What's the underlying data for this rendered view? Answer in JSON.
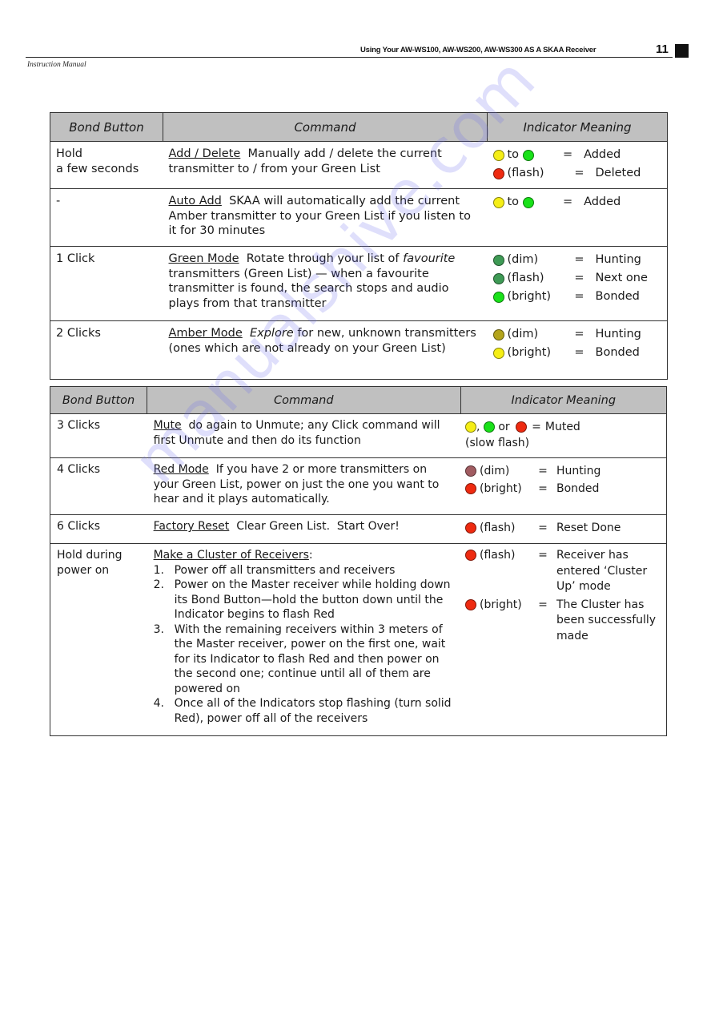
{
  "header": {
    "running_title": "Using Your AW-WS100, AW-WS200, AW-WS300 AS A SKAA Receiver",
    "page_number": "11",
    "manual_label": "Instruction Manual"
  },
  "tables": [
    {
      "headers": [
        "Bond Button",
        "Command",
        "Indicator Meaning"
      ],
      "rows": [
        {
          "button": [
            "Hold",
            "a few seconds"
          ],
          "command_title": "Add / Delete",
          "command_text": "Manually add / delete the current transmitter to / from your Green List",
          "indicators": [
            {
              "dots": [
                "yellow",
                "green"
              ],
              "state": "to",
              "meaning": "Added"
            },
            {
              "dots": [
                "red"
              ],
              "state": "(flash)",
              "meaning": "Deleted"
            }
          ]
        },
        {
          "button": [
            "-"
          ],
          "command_title": "Auto Add",
          "command_text": "SKAA will automatically add the current Amber transmitter to your Green List if you listen to it for 30 minutes",
          "indicators": [
            {
              "dots": [
                "yellow",
                "green"
              ],
              "state": "to",
              "meaning": "Added"
            }
          ]
        },
        {
          "button": [
            "1 Click"
          ],
          "command_title": "Green Mode",
          "command_text_pre": "Rotate through your list of",
          "command_text_em": "favourite",
          "command_text": "transmitters (Green List) — when a favourite transmitter is found, the search stops and audio plays from that transmitter",
          "indicators": [
            {
              "dots": [
                "green-dim"
              ],
              "state": "(dim)",
              "meaning": "Hunting"
            },
            {
              "dots": [
                "green-dim"
              ],
              "state": "(flash)",
              "meaning": "Next one"
            },
            {
              "dots": [
                "green"
              ],
              "state": "(bright)",
              "meaning": "Bonded"
            }
          ]
        },
        {
          "button": [
            "2 Clicks"
          ],
          "command_title": "Amber Mode",
          "command_text_em": "Explore",
          "command_text": "for new, unknown transmitters (ones which are not already on your Green List)",
          "indicators": [
            {
              "dots": [
                "amber-dim"
              ],
              "state": "(dim)",
              "meaning": "Hunting"
            },
            {
              "dots": [
                "yellow"
              ],
              "state": "(bright)",
              "meaning": "Bonded"
            }
          ]
        }
      ]
    },
    {
      "headers": [
        "Bond Button",
        "Command",
        "Indicator Meaning"
      ],
      "rows": [
        {
          "button": [
            "3 Clicks"
          ],
          "command_title": "Mute",
          "command_text": "do again to Unmute; any Click command will first Unmute and then do its function",
          "indicators": [
            {
              "dots": [
                "yellow",
                "green",
                "red"
              ],
              "joiners": [
                ", ",
                " or "
              ],
              "meaning": "Muted",
              "note": "(slow flash)"
            }
          ]
        },
        {
          "button": [
            "4 Clicks"
          ],
          "command_title": "Red Mode",
          "command_text": "If you have 2 or more transmitters on your Green List, power on just the one you want to hear and it plays automatically.",
          "indicators": [
            {
              "dots": [
                "red-dim"
              ],
              "state": "(dim)",
              "meaning": "Hunting"
            },
            {
              "dots": [
                "red"
              ],
              "state": "(bright)",
              "meaning": "Bonded"
            }
          ]
        },
        {
          "button": [
            "6 Clicks"
          ],
          "command_title": "Factory Reset",
          "command_text": "Clear Green List.  Start Over!",
          "indicators": [
            {
              "dots": [
                "red"
              ],
              "state": "(flash)",
              "meaning": "Reset Done"
            }
          ]
        },
        {
          "button": [
            "Hold during",
            "power on"
          ],
          "command_title": "Make a Cluster of Receivers",
          "command_suffix": ":",
          "steps": [
            {
              "num": "1.",
              "text": "Power off all transmitters and receivers"
            },
            {
              "num": "2.",
              "text": "Power on the Master receiver while holding down its Bond Button—hold the button down until the Indicator begins to flash Red"
            },
            {
              "num": "3.",
              "text": "With the remaining receivers within 3 meters of the Master receiver, power on the first one, wait for its Indicator to flash Red and then power on the second one; continue until all of them are powered on"
            },
            {
              "num": "4.",
              "text": "Once all of the Indicators stop flashing (turn solid Red), power off all of the receivers"
            }
          ],
          "indicators": [
            {
              "dots": [
                "red"
              ],
              "state": "(flash)",
              "meaning": "Receiver has entered ‘Cluster Up’ mode"
            },
            {
              "dots": [
                "red"
              ],
              "state": "(bright)",
              "meaning": "The Cluster has been successfully made"
            }
          ]
        }
      ]
    }
  ],
  "indicator_colors": {
    "yellow": "#f5ee16",
    "green": "#19e119",
    "red": "#ee2a10",
    "green-dim": "#3e9a55",
    "amber-dim": "#b3a41b",
    "red-dim": "#a15c61"
  },
  "equals_sign": "=",
  "watermark": "manualshive.com"
}
